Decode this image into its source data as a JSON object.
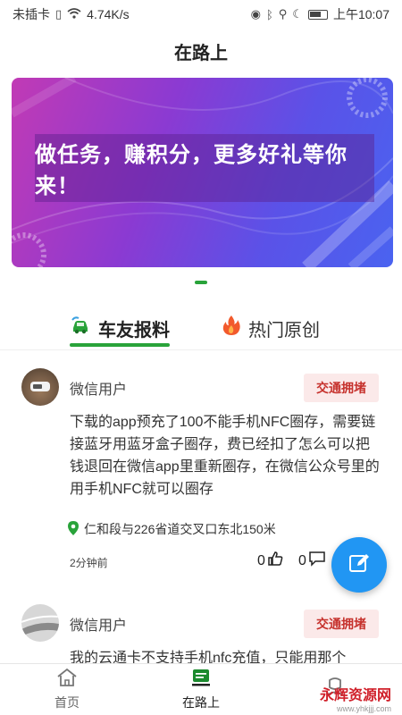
{
  "status_bar": {
    "carrier": "未插卡",
    "speed": "4.74K/s",
    "time": "上午10:07"
  },
  "header": {
    "title": "在路上"
  },
  "banner": {
    "text": "做任务，赚积分，更多好礼等你来！"
  },
  "tabs": [
    {
      "label": "车友报料",
      "active": true
    },
    {
      "label": "热门原创",
      "active": false
    }
  ],
  "posts": [
    {
      "username": "微信用户",
      "tag": "交通拥堵",
      "body": "下载的app预充了100不能手机NFC圈存，需要链接蓝牙用蓝牙盒子圈存，费已经扣了怎么可以把钱退回在微信app里重新圈存，在微信公众号里的用手机NFC就可以圈存",
      "location": "仁和段与226省道交叉口东北150米",
      "time": "2分钟前",
      "likes": "0",
      "comments": "0"
    },
    {
      "username": "微信用户",
      "tag": "交通拥堵",
      "body": "我的云通卡不支持手机nfc充值，只能用那个"
    }
  ],
  "bottom_nav": [
    {
      "label": "首页",
      "icon": "home-icon"
    },
    {
      "label": "在路上",
      "icon": "chat-icon"
    },
    {
      "label": "",
      "icon": "profile-icon"
    }
  ],
  "watermark": {
    "text": "永辉资源网",
    "url": "www.yhkjjj.com"
  },
  "colors": {
    "accent": "#29a33a",
    "tag_text": "#c6322d",
    "fab": "#2196f3"
  }
}
